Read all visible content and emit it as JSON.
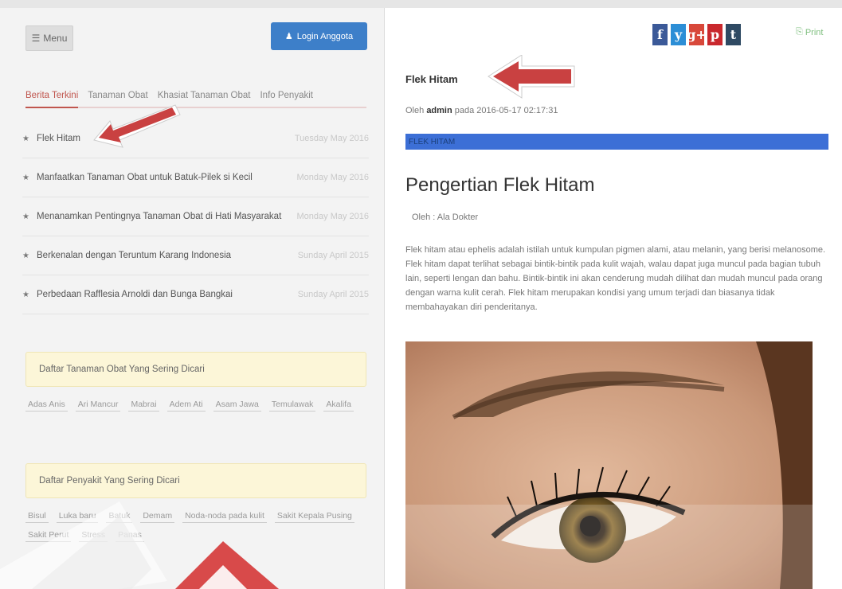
{
  "header": {
    "menu_label": "Menu",
    "login_label": "Login Anggota"
  },
  "tabs": [
    {
      "label": "Berita Terkini",
      "active": true
    },
    {
      "label": "Tanaman Obat",
      "active": false
    },
    {
      "label": "Khasiat Tanaman Obat",
      "active": false
    },
    {
      "label": "Info Penyakit",
      "active": false
    }
  ],
  "news": [
    {
      "title": "Flek Hitam",
      "date": "Tuesday May 2016"
    },
    {
      "title": "Manfaatkan Tanaman Obat untuk Batuk-Pilek si Kecil",
      "date": "Monday May 2016"
    },
    {
      "title": "Menanamkan Pentingnya Tanaman Obat di Hati Masyarakat",
      "date": "Monday May 2016"
    },
    {
      "title": "Berkenalan dengan Teruntum Karang Indonesia",
      "date": "Sunday April 2015"
    },
    {
      "title": "Perbedaan Rafflesia Arnoldi dan Bunga Bangkai",
      "date": "Sunday April 2015"
    }
  ],
  "panels": {
    "tanaman": {
      "title": "Daftar Tanaman Obat Yang Sering Dicari",
      "tags": [
        "Adas Anis",
        "Ari Mancur",
        "Mabrai",
        "Adem Ati",
        "Asam Jawa",
        "Temulawak",
        "Akalifa"
      ]
    },
    "penyakit": {
      "title": "Daftar Penyakit Yang Sering Dicari",
      "tags": [
        "Bisul",
        "Luka baru",
        "Batuk",
        "Demam",
        "Noda-noda pada kulit",
        "Sakit Kepala Pusing",
        "Sakit Perut",
        "Stress",
        "Panas"
      ]
    }
  },
  "article": {
    "title": "Flek Hitam",
    "meta_prefix": "Oleh",
    "meta_author": "admin",
    "meta_suffix": "pada 2016-05-17 02:17:31",
    "category": "FLEK HITAM",
    "heading": "Pengertian Flek Hitam",
    "byline": "Oleh : Ala Dokter",
    "body": "Flek hitam atau ephelis adalah istilah untuk kumpulan pigmen alami, atau melanin, yang berisi melanosome. Flek hitam dapat terlihat sebagai bintik-bintik pada kulit wajah, walau dapat juga muncul pada bagian tubuh lain, seperti lengan dan bahu. Bintik-bintik ini akan cenderung mudah dilihat dan mudah muncul pada orang dengan warna kulit cerah. Flek hitam merupakan kondisi yang umum terjadi dan biasanya tidak membahayakan diri penderitanya."
  },
  "social": [
    {
      "glyph": "f",
      "icon": "facebook-icon",
      "color": "#3b5998"
    },
    {
      "glyph": "y",
      "icon": "twitter-icon",
      "color": "#2c8ed6"
    },
    {
      "glyph": "g+",
      "icon": "google-plus-icon",
      "color": "#d8483a"
    },
    {
      "glyph": "p",
      "icon": "pinterest-icon",
      "color": "#c9282d"
    },
    {
      "glyph": "t",
      "icon": "tumblr-icon",
      "color": "#2f4a63"
    }
  ],
  "print_label": "Print",
  "colors": {
    "accent_blue": "#3d7fc9",
    "tab_active": "#c0564e",
    "panel_bg": "#fcf6d8",
    "category_bar": "#3c6fd6",
    "arrow": "#c94141"
  }
}
